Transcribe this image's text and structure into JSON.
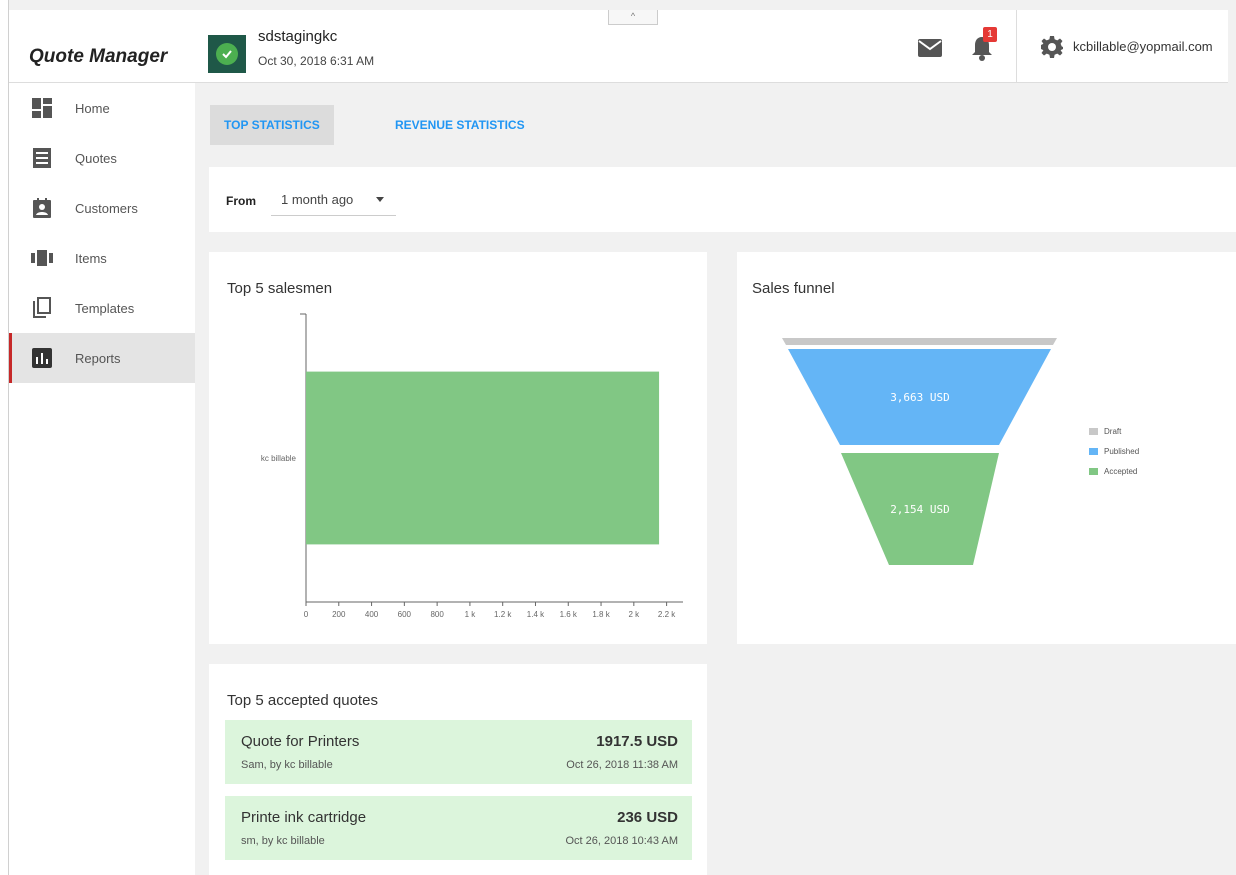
{
  "app": {
    "title": "Quote Manager"
  },
  "header": {
    "tenant_name": "sdstagingkc",
    "tenant_time": "Oct 30, 2018 6:31 AM",
    "notification_count": "1",
    "user_email": "kcbillable@yopmail.com",
    "collapse_glyph": "^",
    "tenant_badge_color": "#1f5848",
    "notification_badge_color": "#e53935"
  },
  "sidebar": {
    "items": [
      {
        "label": "Home",
        "icon": "dashboard-icon"
      },
      {
        "label": "Quotes",
        "icon": "document-list-icon"
      },
      {
        "label": "Customers",
        "icon": "contact-card-icon"
      },
      {
        "label": "Items",
        "icon": "items-icon"
      },
      {
        "label": "Templates",
        "icon": "copy-icon"
      },
      {
        "label": "Reports",
        "icon": "bar-chart-icon",
        "active": true
      }
    ]
  },
  "tabs": [
    {
      "label": "TOP STATISTICS",
      "active": true
    },
    {
      "label": "REVENUE STATISTICS",
      "active": false
    }
  ],
  "filter": {
    "label": "From",
    "value": "1 month ago"
  },
  "salesmen": {
    "title": "Top 5 salesmen",
    "chart_data": {
      "type": "bar",
      "orientation": "horizontal",
      "categories": [
        "kc billable"
      ],
      "values": [
        2154
      ],
      "xlim": [
        0,
        2300
      ],
      "xticks": [
        0,
        200,
        400,
        600,
        800,
        1000,
        1200,
        1400,
        1600,
        1800,
        2000,
        2200
      ],
      "xticklabels": [
        "0",
        "200",
        "400",
        "600",
        "800",
        "1 k",
        "1.2 k",
        "1.4 k",
        "1.6 k",
        "1.8 k",
        "2 k",
        "2.2 k"
      ],
      "color": "#81c784"
    }
  },
  "funnel": {
    "title": "Sales funnel",
    "chart_data": {
      "type": "funnel",
      "stages": [
        {
          "name": "Draft",
          "value": null,
          "label": "",
          "color": "#c8c8c8"
        },
        {
          "name": "Published",
          "value": 3663,
          "label": "3,663 USD",
          "color": "#64b5f6"
        },
        {
          "name": "Accepted",
          "value": 2154,
          "label": "2,154 USD",
          "color": "#81c784"
        }
      ],
      "legend_position": "right"
    }
  },
  "accepted_quotes": {
    "title": "Top 5 accepted quotes",
    "items": [
      {
        "title": "Quote for Printers",
        "subtitle": "Sam, by kc billable",
        "amount": "1917.5 USD",
        "date": "Oct 26, 2018 11:38 AM"
      },
      {
        "title": "Printe ink cartridge",
        "subtitle": "sm, by kc billable",
        "amount": "236 USD",
        "date": "Oct 26, 2018 10:43 AM"
      }
    ],
    "item_color": "#dcf5dc"
  },
  "colors": {
    "accent": "#2196f3",
    "active_marker": "#c62828"
  }
}
